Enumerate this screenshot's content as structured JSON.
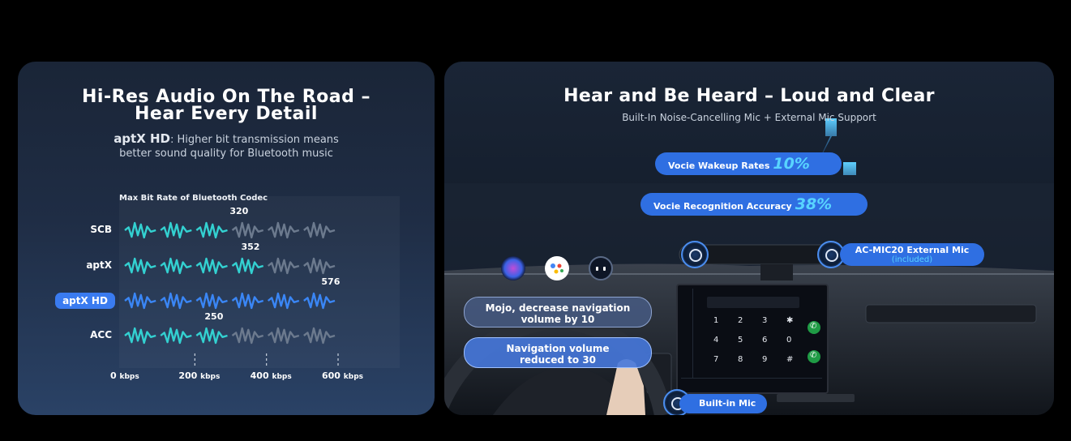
{
  "left_panel": {
    "title_line1": "Hi-Res Audio On The Road –",
    "title_line2": "Hear Every Detail",
    "subtitle_brand": "aptX HD",
    "subtitle_line1": ": Higher bit transmission means",
    "subtitle_line2": "better sound quality for Bluetooth music",
    "chart_caption": "Max Bit Rate of Bluetooth Codec",
    "x_unit": "kbps",
    "x_ticks": [
      "0",
      "200",
      "400",
      "600"
    ],
    "highlight_category": "aptX HD",
    "colors": {
      "active_wave": "#33d1d1",
      "highlight_wave": "#3a86f5",
      "inactive_wave": "#6c7a8e",
      "highlight_pill": "#3a7bf0"
    }
  },
  "chart_data": {
    "type": "bar",
    "categories": [
      "SCB",
      "aptX",
      "aptX HD",
      "ACC"
    ],
    "values": [
      320,
      352,
      576,
      250
    ],
    "value_labels": [
      "320",
      "352",
      "576",
      "250"
    ],
    "xlim": [
      0,
      600
    ],
    "orientation": "horizontal"
  },
  "right_panel": {
    "title": "Hear and Be Heard – Loud and Clear",
    "subtitle": "Built-In Noise-Cancelling Mic + External Mic Support",
    "stat1_label": "Vocie Wakeup Rates",
    "stat1_value": "10%",
    "stat2_label": "Vocie Recognition Accuracy",
    "stat2_value": "38%",
    "external_mic_label": "AC-MIC20 External Mic",
    "external_mic_note": "(included)",
    "voice_command": "Mojo, decrease navigation volume by 10",
    "voice_command_line1": "Mojo, decrease navigation",
    "voice_command_line2": "volume by 10",
    "voice_reply_line1": "Navigation volume",
    "voice_reply_line2": "reduced to 30",
    "builtin_mic_label": "Built-in Mic",
    "colors": {
      "pill": "#2f6fe2",
      "accent": "#58d4ff"
    },
    "keypad": [
      "1",
      "2",
      "3",
      "✱",
      "4",
      "5",
      "6",
      "0",
      "7",
      "8",
      "9",
      "#"
    ]
  }
}
